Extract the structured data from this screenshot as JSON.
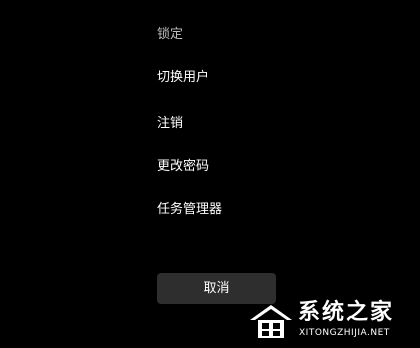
{
  "menu": {
    "items": [
      {
        "label": "锁定"
      },
      {
        "label": "切换用户"
      },
      {
        "label": "注销"
      },
      {
        "label": "更改密码"
      },
      {
        "label": "任务管理器"
      }
    ]
  },
  "cancel_button": {
    "label": "取消"
  },
  "watermark": {
    "title": "系统之家",
    "url": "XITONGZHIJIA.NET"
  },
  "colors": {
    "background": "#000000",
    "text": "#ffffff",
    "button_bg": "#2e2e2e"
  }
}
